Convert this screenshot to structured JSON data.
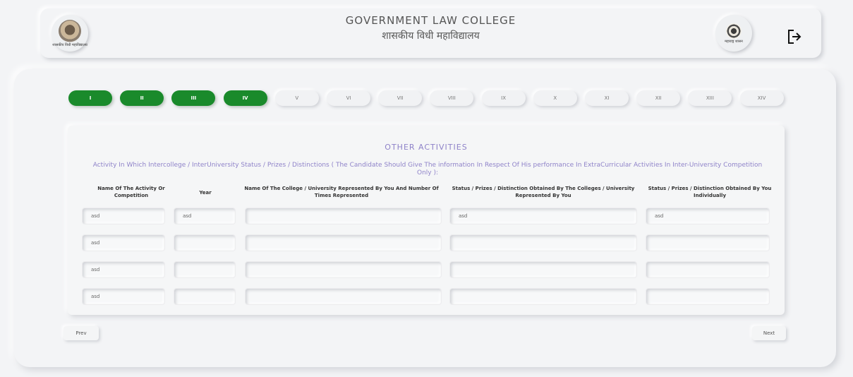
{
  "header": {
    "title_en": "GOVERNMENT LAW COLLEGE",
    "title_hi": "शासकीय विधी महाविद्यालय",
    "left_logo_caption": "शासकीय विधी महाविद्यालय",
    "right_logo_caption": "महाराष्ट्र शासन"
  },
  "tabs": [
    "I",
    "II",
    "III",
    "IV",
    "V",
    "VI",
    "VII",
    "VIII",
    "IX",
    "X",
    "XI",
    "XII",
    "XIII",
    "XIV"
  ],
  "active_tabs": [
    "I",
    "II",
    "III",
    "IV"
  ],
  "section": {
    "title": "OTHER ACTIVITIES",
    "description": "Activity In Which Intercollege / InterUniversity Status / Prizes / Distinctions ( The Candidate Should Give The information In Respect Of His performance In ExtraCurricular Activities In Inter-University Competition Only ):"
  },
  "table": {
    "columns": [
      "Name Of The Activity Or Competition",
      "Year",
      "Name Of The College / University Represented By You And Number Of Times Represented",
      "Status / Prizes / Distinction Obtained By The Colleges / University Represented By You",
      "Status / Prizes / Distinction Obtained By You Individually"
    ],
    "rows": [
      [
        "asd",
        "asd",
        "",
        "asd",
        "asd"
      ],
      [
        "asd",
        "",
        "",
        "",
        ""
      ],
      [
        "asd",
        "",
        "",
        "",
        ""
      ],
      [
        "asd",
        "",
        "",
        "",
        ""
      ]
    ]
  },
  "nav": {
    "prev": "Prev",
    "next": "Next"
  },
  "colors": {
    "active_tab": "#1a8a2b",
    "accent_text": "#8f83c9",
    "background": "#f3f4f6"
  }
}
